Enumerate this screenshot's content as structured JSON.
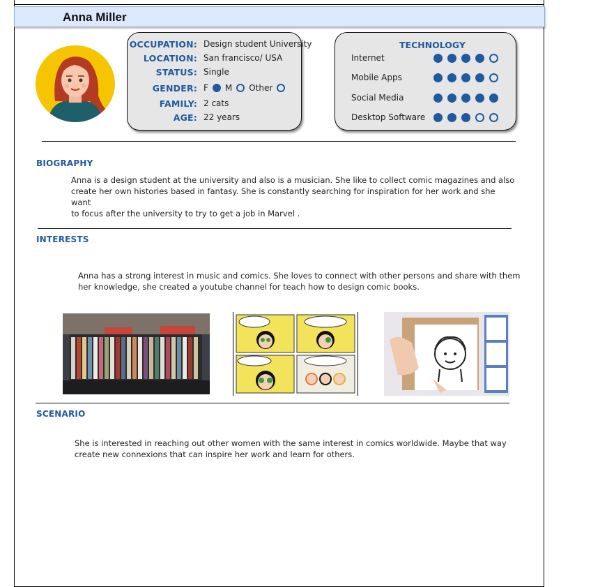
{
  "header": {
    "name": "Anna Miller"
  },
  "profile": {
    "occupation_label": "OCCUPATION:",
    "occupation": "Design student University",
    "location_label": "LOCATION:",
    "location": "San francisco/ USA",
    "status_label": "STATUS:",
    "status": "Single",
    "gender_label": "GENDER:",
    "gender_options": [
      "F",
      "M",
      "Other"
    ],
    "gender_selected": "F",
    "family_label": "FAMILY:",
    "family": "2 cats",
    "age_label": "AGE:",
    "age": "22 years"
  },
  "technology": {
    "title": "TECHNOLOGY",
    "scale_max": 5,
    "items": [
      {
        "label": "Internet",
        "level": 4
      },
      {
        "label": "Mobile Apps",
        "level": 4
      },
      {
        "label": "Social Media",
        "level": 5
      },
      {
        "label": "Desktop Software",
        "level": 3
      }
    ]
  },
  "biography": {
    "title": "BIOGRAPHY",
    "lines": [
      "Anna is a design student at the university and also is a musician. She like to collect comic magazines and also",
      "create her own histories based in fantasy. She is constantly searching for inspiration for her work and she want",
      "to focus after the university to try to get a job in Marvel ."
    ]
  },
  "interests": {
    "title": "INTERESTS",
    "lines": [
      "Anna has a strong interest in music and comics. She loves to connect with other persons and share with them",
      "her knowledge, she created a youtube channel for teach how to design comic books."
    ]
  },
  "scenario": {
    "title": "SCENARIO",
    "lines": [
      "She is interested in reaching out other women with the same interest in comics worldwide. Maybe that way",
      "create new connexions that can inspire her work and learn for others."
    ]
  },
  "colors": {
    "accent": "#1f5aa0",
    "header_bg": "#dce8fb",
    "box_bg": "#e6e6e6",
    "avatar_bg": "#f6c400"
  }
}
